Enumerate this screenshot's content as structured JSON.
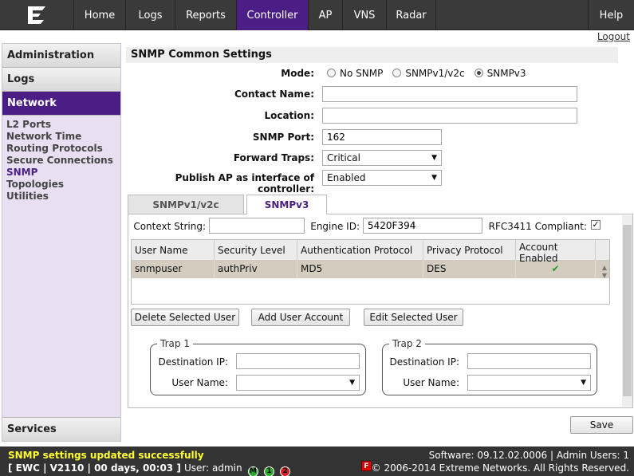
{
  "nav": {
    "tabs": [
      {
        "label": "Home"
      },
      {
        "label": "Logs"
      },
      {
        "label": "Reports"
      },
      {
        "label": "Controller"
      },
      {
        "label": "AP"
      },
      {
        "label": "VNS"
      },
      {
        "label": "Radar"
      }
    ],
    "help": "Help",
    "active_color": "#4b1e86"
  },
  "logout": "Logout",
  "sidebar": {
    "sections": [
      "Administration",
      "Logs",
      "Network"
    ],
    "links": [
      "L2 Ports",
      "Network Time",
      "Routing Protocols",
      "Secure Connections",
      "SNMP",
      "Topologies",
      "Utilities"
    ],
    "bottom": "Services"
  },
  "common": {
    "title": "SNMP Common Settings",
    "mode_label": "Mode:",
    "mode_options": [
      "No SNMP",
      "SNMPv1/v2c",
      "SNMPv3"
    ],
    "contact_label": "Contact Name:",
    "contact_value": "",
    "location_label": "Location:",
    "location_value": "",
    "port_label": "SNMP Port:",
    "port_value": "162",
    "traps_label": "Forward Traps:",
    "traps_value": "Critical",
    "publish_label": "Publish AP as interface of controller:",
    "publish_value": "Enabled"
  },
  "tabs": [
    "SNMPv1/v2c",
    "SNMPv3"
  ],
  "v3": {
    "context_label": "Context String:",
    "context_value": "",
    "engine_label": "Engine ID:",
    "engine_value": "5420F394",
    "rfc_label": "RFC3411 Compliant:",
    "columns": [
      "User Name",
      "Security Level",
      "Authentication Protocol",
      "Privacy Protocol",
      "Account Enabled"
    ],
    "rows": [
      {
        "user": "snmpuser",
        "level": "authPriv",
        "auth": "MD5",
        "privacy": "DES",
        "enabled": "✔"
      }
    ],
    "delete_btn": "Delete Selected User",
    "add_btn": "Add User Account",
    "edit_btn": "Edit Selected User",
    "trap1": {
      "legend": "Trap 1",
      "dest_label": "Destination IP:",
      "dest_value": "",
      "user_label": "User Name:",
      "user_value": ""
    },
    "trap2": {
      "legend": "Trap 2",
      "dest_label": "Destination IP:",
      "dest_value": "",
      "user_label": "User Name:",
      "user_value": ""
    }
  },
  "save_btn": "Save",
  "status": {
    "message": "SNMP settings updated successfully",
    "info": "[ EWC | V2110 | 00 days, 00:03 ]",
    "user": "User: admin",
    "badges": [
      "M",
      "1",
      "2"
    ],
    "f_badge": "F",
    "software": "Software: 09.12.02.0006 | Admin Users: 1",
    "copyright": "© 2006-2014  Extreme Networks. All Rights Reserved."
  }
}
